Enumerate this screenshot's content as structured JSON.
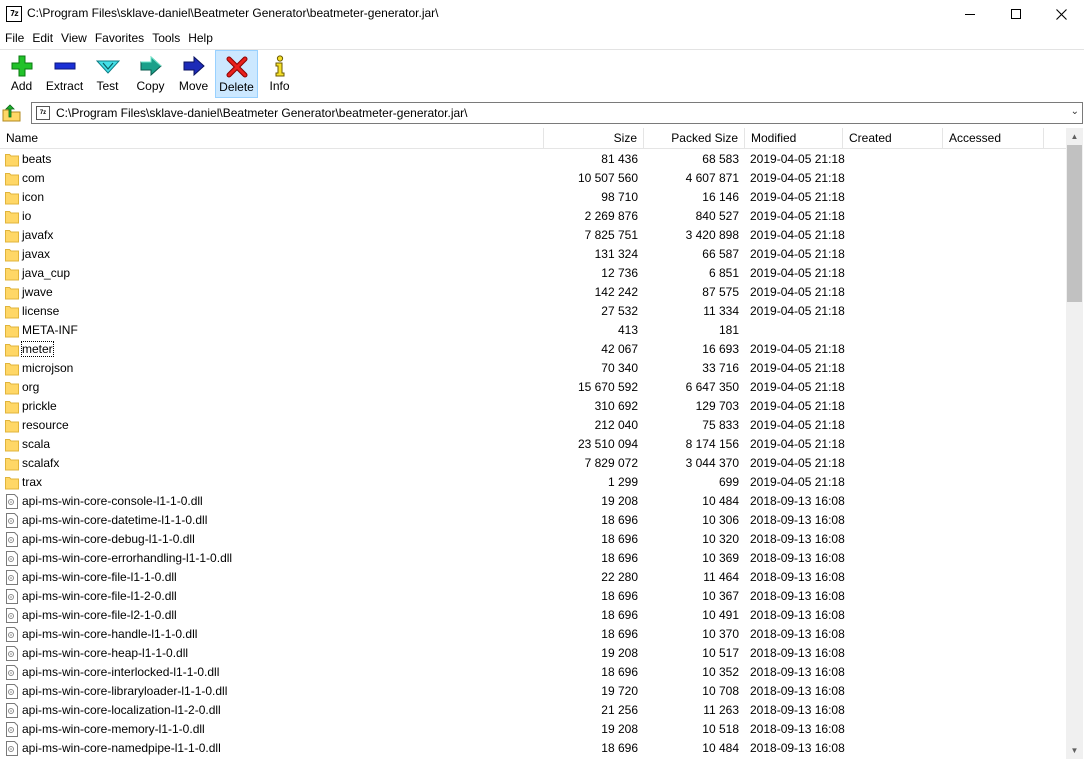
{
  "window": {
    "title": "C:\\Program Files\\sklave-daniel\\Beatmeter Generator\\beatmeter-generator.jar\\",
    "app_icon_text": "7z",
    "minimize": "—",
    "maximize": "☐",
    "close": "✕"
  },
  "menu": [
    "File",
    "Edit",
    "View",
    "Favorites",
    "Tools",
    "Help"
  ],
  "toolbar": [
    {
      "label": "Add",
      "icon": "plus-icon"
    },
    {
      "label": "Extract",
      "icon": "minus-icon"
    },
    {
      "label": "Test",
      "icon": "test-check-icon"
    },
    {
      "label": "Copy",
      "icon": "copy-arrow-icon"
    },
    {
      "label": "Move",
      "icon": "move-arrow-icon"
    },
    {
      "label": "Delete",
      "icon": "delete-x-icon",
      "selected": true
    },
    {
      "label": "Info",
      "icon": "info-icon"
    }
  ],
  "address": {
    "path": "C:\\Program Files\\sklave-daniel\\Beatmeter Generator\\beatmeter-generator.jar\\"
  },
  "columns": {
    "name": "Name",
    "size": "Size",
    "packed": "Packed Size",
    "modified": "Modified",
    "created": "Created",
    "accessed": "Accessed"
  },
  "rows": [
    {
      "type": "folder",
      "name": "beats",
      "size": "81 436",
      "packed": "68 583",
      "modified": "2019-04-05 21:18"
    },
    {
      "type": "folder",
      "name": "com",
      "size": "10 507 560",
      "packed": "4 607 871",
      "modified": "2019-04-05 21:18"
    },
    {
      "type": "folder",
      "name": "icon",
      "size": "98 710",
      "packed": "16 146",
      "modified": "2019-04-05 21:18"
    },
    {
      "type": "folder",
      "name": "io",
      "size": "2 269 876",
      "packed": "840 527",
      "modified": "2019-04-05 21:18"
    },
    {
      "type": "folder",
      "name": "javafx",
      "size": "7 825 751",
      "packed": "3 420 898",
      "modified": "2019-04-05 21:18"
    },
    {
      "type": "folder",
      "name": "javax",
      "size": "131 324",
      "packed": "66 587",
      "modified": "2019-04-05 21:18"
    },
    {
      "type": "folder",
      "name": "java_cup",
      "size": "12 736",
      "packed": "6 851",
      "modified": "2019-04-05 21:18"
    },
    {
      "type": "folder",
      "name": "jwave",
      "size": "142 242",
      "packed": "87 575",
      "modified": "2019-04-05 21:18"
    },
    {
      "type": "folder",
      "name": "license",
      "size": "27 532",
      "packed": "11 334",
      "modified": "2019-04-05 21:18"
    },
    {
      "type": "folder",
      "name": "META-INF",
      "size": "413",
      "packed": "181",
      "modified": ""
    },
    {
      "type": "folder",
      "name": "meter",
      "size": "42 067",
      "packed": "16 693",
      "modified": "2019-04-05 21:18",
      "focused": true
    },
    {
      "type": "folder",
      "name": "microjson",
      "size": "70 340",
      "packed": "33 716",
      "modified": "2019-04-05 21:18"
    },
    {
      "type": "folder",
      "name": "org",
      "size": "15 670 592",
      "packed": "6 647 350",
      "modified": "2019-04-05 21:18"
    },
    {
      "type": "folder",
      "name": "prickle",
      "size": "310 692",
      "packed": "129 703",
      "modified": "2019-04-05 21:18"
    },
    {
      "type": "folder",
      "name": "resource",
      "size": "212 040",
      "packed": "75 833",
      "modified": "2019-04-05 21:18"
    },
    {
      "type": "folder",
      "name": "scala",
      "size": "23 510 094",
      "packed": "8 174 156",
      "modified": "2019-04-05 21:18"
    },
    {
      "type": "folder",
      "name": "scalafx",
      "size": "7 829 072",
      "packed": "3 044 370",
      "modified": "2019-04-05 21:18"
    },
    {
      "type": "folder",
      "name": "trax",
      "size": "1 299",
      "packed": "699",
      "modified": "2019-04-05 21:18"
    },
    {
      "type": "file",
      "name": "api-ms-win-core-console-l1-1-0.dll",
      "size": "19 208",
      "packed": "10 484",
      "modified": "2018-09-13 16:08"
    },
    {
      "type": "file",
      "name": "api-ms-win-core-datetime-l1-1-0.dll",
      "size": "18 696",
      "packed": "10 306",
      "modified": "2018-09-13 16:08"
    },
    {
      "type": "file",
      "name": "api-ms-win-core-debug-l1-1-0.dll",
      "size": "18 696",
      "packed": "10 320",
      "modified": "2018-09-13 16:08"
    },
    {
      "type": "file",
      "name": "api-ms-win-core-errorhandling-l1-1-0.dll",
      "size": "18 696",
      "packed": "10 369",
      "modified": "2018-09-13 16:08"
    },
    {
      "type": "file",
      "name": "api-ms-win-core-file-l1-1-0.dll",
      "size": "22 280",
      "packed": "11 464",
      "modified": "2018-09-13 16:08"
    },
    {
      "type": "file",
      "name": "api-ms-win-core-file-l1-2-0.dll",
      "size": "18 696",
      "packed": "10 367",
      "modified": "2018-09-13 16:08"
    },
    {
      "type": "file",
      "name": "api-ms-win-core-file-l2-1-0.dll",
      "size": "18 696",
      "packed": "10 491",
      "modified": "2018-09-13 16:08"
    },
    {
      "type": "file",
      "name": "api-ms-win-core-handle-l1-1-0.dll",
      "size": "18 696",
      "packed": "10 370",
      "modified": "2018-09-13 16:08"
    },
    {
      "type": "file",
      "name": "api-ms-win-core-heap-l1-1-0.dll",
      "size": "19 208",
      "packed": "10 517",
      "modified": "2018-09-13 16:08"
    },
    {
      "type": "file",
      "name": "api-ms-win-core-interlocked-l1-1-0.dll",
      "size": "18 696",
      "packed": "10 352",
      "modified": "2018-09-13 16:08"
    },
    {
      "type": "file",
      "name": "api-ms-win-core-libraryloader-l1-1-0.dll",
      "size": "19 720",
      "packed": "10 708",
      "modified": "2018-09-13 16:08"
    },
    {
      "type": "file",
      "name": "api-ms-win-core-localization-l1-2-0.dll",
      "size": "21 256",
      "packed": "11 263",
      "modified": "2018-09-13 16:08"
    },
    {
      "type": "file",
      "name": "api-ms-win-core-memory-l1-1-0.dll",
      "size": "19 208",
      "packed": "10 518",
      "modified": "2018-09-13 16:08"
    },
    {
      "type": "file",
      "name": "api-ms-win-core-namedpipe-l1-1-0.dll",
      "size": "18 696",
      "packed": "10 484",
      "modified": "2018-09-13 16:08"
    }
  ],
  "colors": {
    "folder": "#ffd766",
    "folder_edge": "#e0b43c",
    "selected_tool": "#cce8ff"
  }
}
